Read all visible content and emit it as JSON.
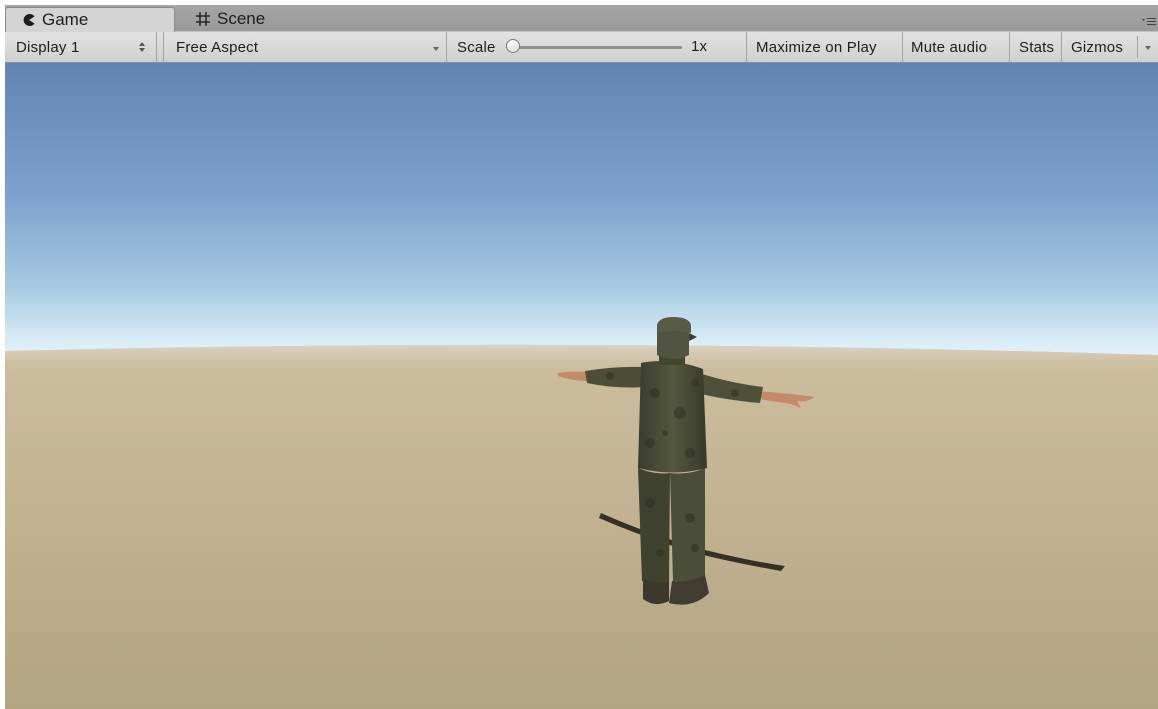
{
  "tabs": [
    {
      "label": "Game",
      "icon": "pacman-icon",
      "active": true
    },
    {
      "label": "Scene",
      "icon": "hash-icon",
      "active": false
    }
  ],
  "toolbar": {
    "display": "Display 1",
    "aspect": "Free Aspect",
    "scale_label": "Scale",
    "scale_value": "1x",
    "scale_fraction": 0.0,
    "maximize_label": "Maximize on Play",
    "mute_label": "Mute audio",
    "stats_label": "Stats",
    "gizmos_label": "Gizmos"
  },
  "viewport": {
    "scene": "skybox with sandy ground plane and a soldier character in T-pose",
    "colors": {
      "sky_top": "#6384b3",
      "sky_horizon": "#eaf4fb",
      "ground": "#cdbb9a",
      "uniform": "#4a4c36",
      "skin": "#c58a6a"
    }
  }
}
